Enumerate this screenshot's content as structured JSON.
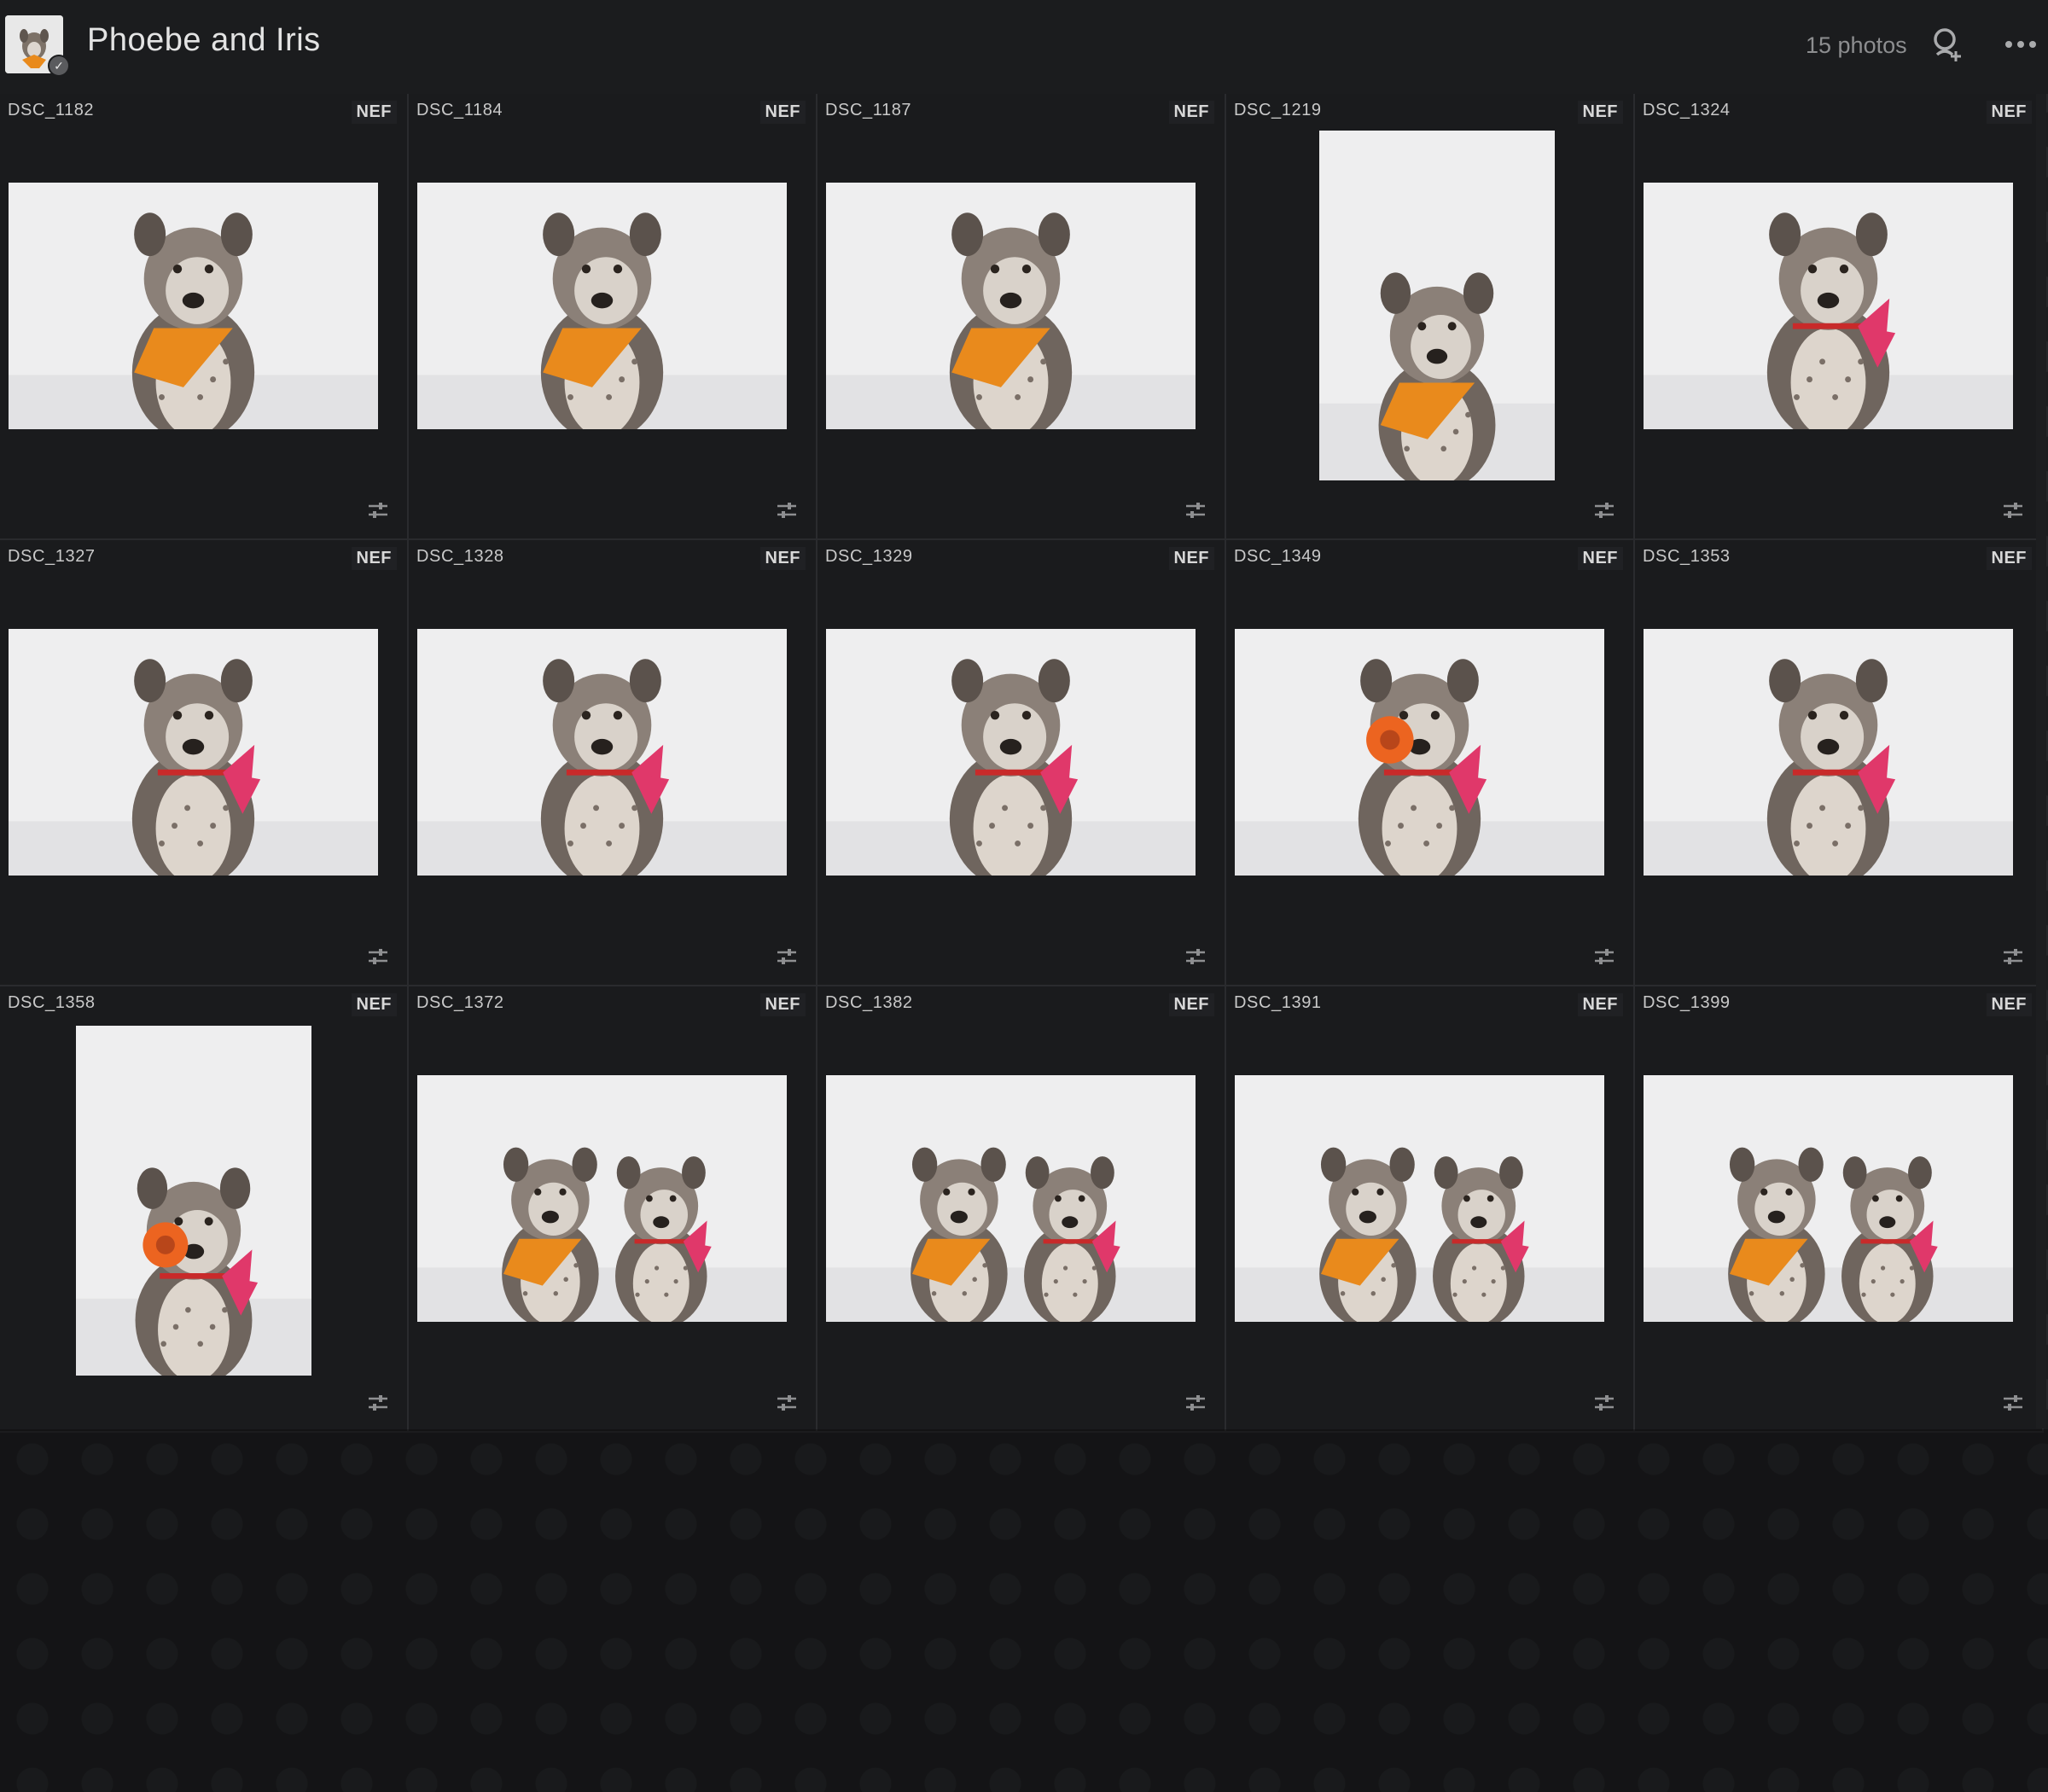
{
  "header": {
    "album_title": "Phoebe and Iris",
    "photo_count": "15 photos",
    "share_icon": "add-person-icon",
    "more_icon": "more-dots-icon"
  },
  "colors": {
    "background": "#1c1d1f",
    "header": "#1b1c1e",
    "orange_bandana": "#e98a1c",
    "pink_bow": "#e0386a",
    "red_collar": "#c82a2a"
  },
  "photos": [
    {
      "name": "DSC_1182",
      "badge": "NEF",
      "orientation": "landscape",
      "subject": "single-orange-bandana"
    },
    {
      "name": "DSC_1184",
      "badge": "NEF",
      "orientation": "landscape",
      "subject": "single-orange-bandana-tongue"
    },
    {
      "name": "DSC_1187",
      "badge": "NEF",
      "orientation": "landscape",
      "subject": "single-orange-bandana-smile"
    },
    {
      "name": "DSC_1219",
      "badge": "NEF",
      "orientation": "portrait",
      "subject": "single-orange-bandana-sitting"
    },
    {
      "name": "DSC_1324",
      "badge": "NEF",
      "orientation": "landscape",
      "subject": "single-pink-bow"
    },
    {
      "name": "DSC_1327",
      "badge": "NEF",
      "orientation": "landscape",
      "subject": "single-pink-bow"
    },
    {
      "name": "DSC_1328",
      "badge": "NEF",
      "orientation": "landscape",
      "subject": "single-pink-bow"
    },
    {
      "name": "DSC_1329",
      "badge": "NEF",
      "orientation": "landscape",
      "subject": "single-pink-bow"
    },
    {
      "name": "DSC_1349",
      "badge": "NEF",
      "orientation": "landscape",
      "subject": "single-pink-bow-toy"
    },
    {
      "name": "DSC_1353",
      "badge": "NEF",
      "orientation": "landscape",
      "subject": "single-pink-bow-closeup"
    },
    {
      "name": "DSC_1358",
      "badge": "NEF",
      "orientation": "portrait",
      "subject": "single-pink-bow-toy"
    },
    {
      "name": "DSC_1372",
      "badge": "NEF",
      "orientation": "landscape",
      "subject": "pair"
    },
    {
      "name": "DSC_1382",
      "badge": "NEF",
      "orientation": "landscape",
      "subject": "pair"
    },
    {
      "name": "DSC_1391",
      "badge": "NEF",
      "orientation": "landscape",
      "subject": "pair"
    },
    {
      "name": "DSC_1399",
      "badge": "NEF",
      "orientation": "landscape",
      "subject": "pair"
    }
  ],
  "cell_icons": {
    "adjust": "sliders-adjust-icon"
  }
}
